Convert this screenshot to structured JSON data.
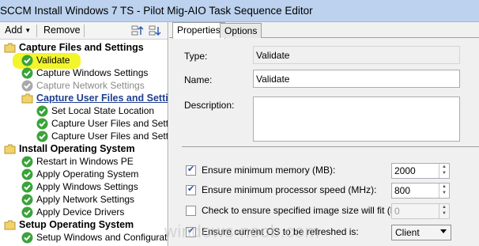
{
  "window": {
    "title": "SCCM Install Windows 7 TS - Pilot Mig-AIO Task Sequence Editor"
  },
  "toolbar": {
    "add_label": "Add",
    "remove_label": "Remove",
    "move_up_icon": "move-up-icon",
    "move_down_icon": "move-down-icon"
  },
  "tree": {
    "nodes": [
      {
        "label": "Capture Files and Settings",
        "kind": "group",
        "icon": "folder-icon"
      },
      {
        "label": "Validate",
        "kind": "step",
        "icon": "green-check-icon",
        "highlighted": true
      },
      {
        "label": "Capture Windows Settings",
        "kind": "step",
        "icon": "green-check-icon"
      },
      {
        "label": "Capture Network Settings",
        "kind": "step-disabled",
        "icon": "gray-check-icon"
      },
      {
        "label": "Capture User Files and Settings",
        "kind": "subgroup",
        "icon": "folder-icon"
      },
      {
        "label": "Set Local State Location",
        "kind": "step",
        "icon": "green-check-icon"
      },
      {
        "label": "Capture User Files and Settings",
        "kind": "step",
        "icon": "green-check-icon"
      },
      {
        "label": "Capture User Files and Settings",
        "kind": "step",
        "icon": "green-check-icon"
      },
      {
        "label": "Install Operating System",
        "kind": "group",
        "icon": "folder-icon"
      },
      {
        "label": "Restart in Windows PE",
        "kind": "step",
        "icon": "green-check-icon"
      },
      {
        "label": "Apply Operating System",
        "kind": "step",
        "icon": "green-check-icon"
      },
      {
        "label": "Apply Windows Settings",
        "kind": "step",
        "icon": "green-check-icon"
      },
      {
        "label": "Apply Network Settings",
        "kind": "step",
        "icon": "green-check-icon"
      },
      {
        "label": "Apply Device Drivers",
        "kind": "step",
        "icon": "green-check-icon"
      },
      {
        "label": "Setup Operating System",
        "kind": "group",
        "icon": "folder-icon"
      },
      {
        "label": "Setup Windows and Configuration",
        "kind": "step",
        "icon": "green-check-icon"
      }
    ]
  },
  "tabs": [
    {
      "label": "Properties",
      "active": true
    },
    {
      "label": "Options",
      "active": false
    }
  ],
  "properties": {
    "type_label": "Type:",
    "type_value": "Validate",
    "name_label": "Name:",
    "name_value": "Validate",
    "description_label": "Description:",
    "description_value": ""
  },
  "checks": [
    {
      "label": "Ensure minimum memory (MB):",
      "checked": true,
      "value": "2000",
      "control": "spin"
    },
    {
      "label": "Ensure minimum processor speed (MHz):",
      "checked": true,
      "value": "800",
      "control": "spin"
    },
    {
      "label": "Check to ensure specified image size will fit (MB):",
      "checked": false,
      "value": "0",
      "control": "spin-disabled"
    },
    {
      "label": "Ensure current OS to be refreshed is:",
      "checked": true,
      "value": "Client",
      "control": "dropdown"
    }
  ],
  "watermark": "windows-noob.com",
  "colors": {
    "highlight": "#f3f52c",
    "titlebar": "#bcd2ee",
    "check_green": "#3aa33a",
    "subgroup_link": "#1f3f8f"
  }
}
